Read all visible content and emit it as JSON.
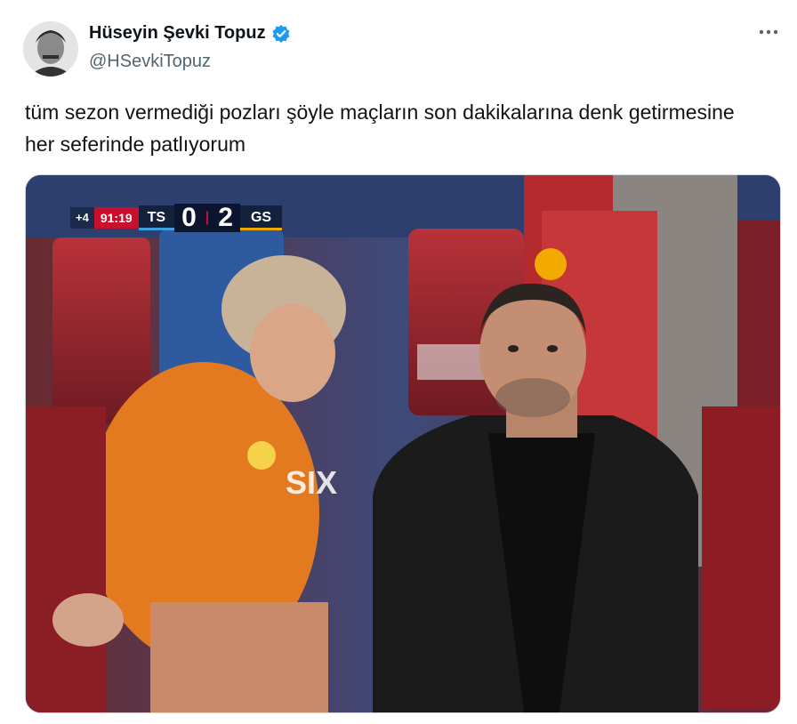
{
  "author": {
    "name": "Hüseyin Şevki Topuz",
    "handle": "@HSevkiTopuz",
    "verified_color": "#1d9bf0"
  },
  "tweet": {
    "text": "tüm sezon vermediği pozları şöyle maçların son dakikalarına denk getirmesine her seferinde patlıyorum"
  },
  "scoreboard": {
    "extra_time": "+4",
    "clock": "91:19",
    "home_team": "TS",
    "home_score": "0",
    "away_score": "2",
    "away_team": "GS"
  },
  "icons": {
    "avatar": "author-avatar",
    "verified": "verified-badge-icon",
    "more": "more-options-icon"
  }
}
